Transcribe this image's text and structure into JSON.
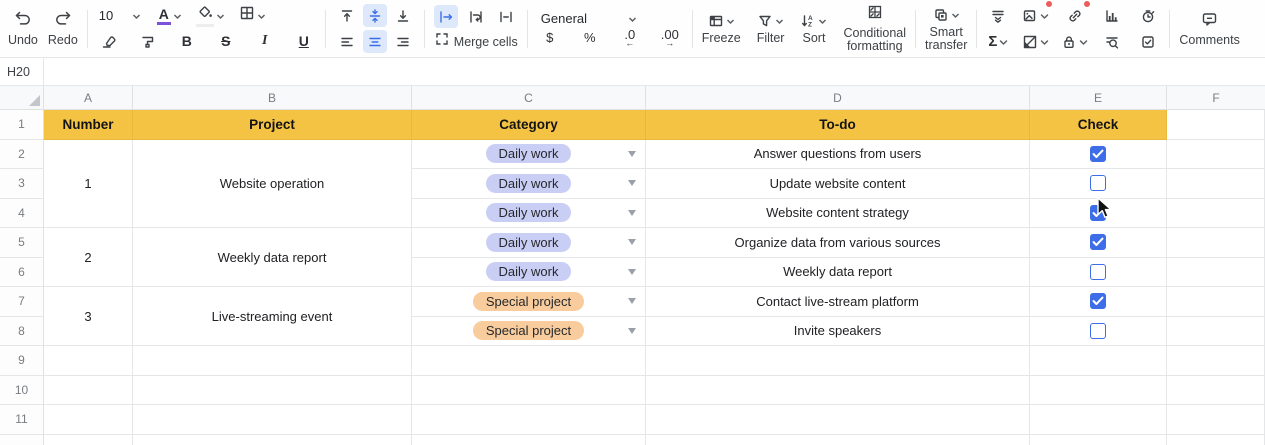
{
  "toolbar": {
    "undo_label": "Undo",
    "redo_label": "Redo",
    "font_size": "10",
    "font_color_letter": "A",
    "bold": "B",
    "strike": "S",
    "italic": "I",
    "underline": "U",
    "merge_cells_label": "Merge cells",
    "number_format": "General",
    "currency": "$",
    "percent": "%",
    "dec_decrease": ".0",
    "dec_increase": ".00",
    "freeze_label": "Freeze",
    "filter_label": "Filter",
    "sort_label": "Sort",
    "conditional_formatting_label": "Conditional\nformatting",
    "smart_transfer_label": "Smart\ntransfer",
    "sum_sigma": "Σ",
    "comments_label": "Comments"
  },
  "formula_bar": {
    "name_box": "H20",
    "formula": ""
  },
  "sheet": {
    "column_headers": [
      "A",
      "B",
      "C",
      "D",
      "E",
      "F"
    ],
    "row_numbers": [
      "1",
      "2",
      "3",
      "4",
      "5",
      "6",
      "7",
      "8",
      "9",
      "10",
      "11"
    ],
    "header_row": {
      "number": "Number",
      "project": "Project",
      "category": "Category",
      "todo": "To-do",
      "check": "Check"
    },
    "groups": [
      {
        "number": "1",
        "project": "Website operation",
        "rows": [
          {
            "category": "Daily work",
            "type": "daily",
            "todo": "Answer questions from users",
            "checked": true
          },
          {
            "category": "Daily work",
            "type": "daily",
            "todo": "Update website content",
            "checked": false
          },
          {
            "category": "Daily work",
            "type": "daily",
            "todo": "Website content strategy",
            "checked": true
          }
        ]
      },
      {
        "number": "2",
        "project": "Weekly data report",
        "rows": [
          {
            "category": "Daily work",
            "type": "daily",
            "todo": "Organize data from various sources",
            "checked": true
          },
          {
            "category": "Daily work",
            "type": "daily",
            "todo": "Weekly data report",
            "checked": false
          }
        ]
      },
      {
        "number": "3",
        "project": "Live-streaming event",
        "rows": [
          {
            "category": "Special project",
            "type": "special",
            "todo": "Contact live-stream platform",
            "checked": true
          },
          {
            "category": "Special project",
            "type": "special",
            "todo": "Invite speakers",
            "checked": false
          }
        ]
      }
    ]
  },
  "colors": {
    "header_yellow": "#F5C344",
    "daily_pill": "#C9CEF5",
    "special_pill": "#F8CC9C",
    "checkbox_blue": "#3D6EE8",
    "active_tool_bg": "#DDE8FB",
    "font_color_underline": "#7B52D9",
    "notification_red": "#EA5D5D"
  }
}
